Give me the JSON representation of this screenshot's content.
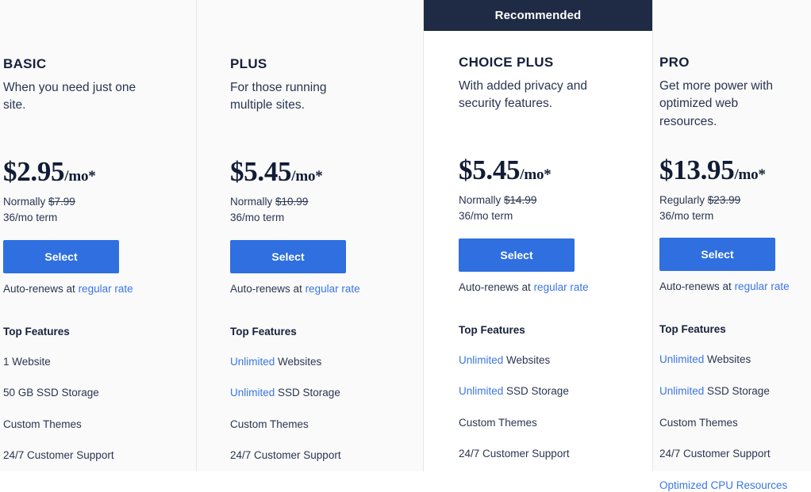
{
  "colors": {
    "accent_blue": "#3b76e3",
    "button_blue": "#2f6fe0",
    "ribbon_navy": "#1f2a44",
    "text_dark": "#16203a",
    "panel_grey": "#fafafa",
    "panel_white": "#ffffff"
  },
  "ribbon": {
    "label": "Recommended"
  },
  "common": {
    "features_title": "Top Features",
    "select_label": "Select",
    "autorenew_prefix": "Auto-renews at",
    "autorenew_link": "regular rate",
    "term": "36/mo term"
  },
  "plans": [
    {
      "name": "BASIC",
      "tagline": "When you need just one site.",
      "price": "$2.95",
      "price_suffix": "/mo*",
      "normally_label": "Normally",
      "normally_price": "$7.99",
      "term": "36/mo term",
      "select_label": "Select",
      "autorenew_prefix": "Auto-renews at",
      "autorenew_link": "regular rate",
      "features_title": "Top Features",
      "features": [
        {
          "highlight": "",
          "text": "1 Website"
        },
        {
          "highlight": "",
          "text": "50 GB SSD Storage"
        },
        {
          "highlight": "",
          "text": "Custom Themes"
        },
        {
          "highlight": "",
          "text": "24/7 Customer Support"
        }
      ]
    },
    {
      "name": "PLUS",
      "tagline": "For those running multiple sites.",
      "price": "$5.45",
      "price_suffix": "/mo*",
      "normally_label": "Normally",
      "normally_price": "$10.99",
      "term": "36/mo term",
      "select_label": "Select",
      "autorenew_prefix": "Auto-renews at",
      "autorenew_link": "regular rate",
      "features_title": "Top Features",
      "features": [
        {
          "highlight": "Unlimited",
          "text": " Websites"
        },
        {
          "highlight": "Unlimited",
          "text": " SSD Storage"
        },
        {
          "highlight": "",
          "text": "Custom Themes"
        },
        {
          "highlight": "",
          "text": "24/7 Customer Support"
        }
      ]
    },
    {
      "name": "CHOICE PLUS",
      "tagline": "With added privacy and security features.",
      "price": "$5.45",
      "price_suffix": "/mo*",
      "normally_label": "Normally",
      "normally_price": "$14.99",
      "term": "36/mo term",
      "select_label": "Select",
      "autorenew_prefix": "Auto-renews at",
      "autorenew_link": "regular rate",
      "features_title": "Top Features",
      "recommended": true,
      "features": [
        {
          "highlight": "Unlimited",
          "text": " Websites"
        },
        {
          "highlight": "Unlimited",
          "text": " SSD Storage"
        },
        {
          "highlight": "",
          "text": "Custom Themes"
        },
        {
          "highlight": "",
          "text": "24/7 Customer Support"
        }
      ]
    },
    {
      "name": "PRO",
      "tagline": "Get more power with optimized web resources.",
      "price": "$13.95",
      "price_suffix": "/mo*",
      "normally_label": "Regularly",
      "normally_price": "$23.99",
      "term": "36/mo term",
      "select_label": "Select",
      "autorenew_prefix": "Auto-renews at",
      "autorenew_link": "regular rate",
      "features_title": "Top Features",
      "features": [
        {
          "highlight": "Unlimited",
          "text": " Websites"
        },
        {
          "highlight": "Unlimited",
          "text": " SSD Storage"
        },
        {
          "highlight": "",
          "text": "Custom Themes"
        },
        {
          "highlight": "",
          "text": "24/7 Customer Support"
        },
        {
          "highlight": "",
          "text": "Optimized CPU Resources",
          "all_link": true
        }
      ]
    }
  ]
}
